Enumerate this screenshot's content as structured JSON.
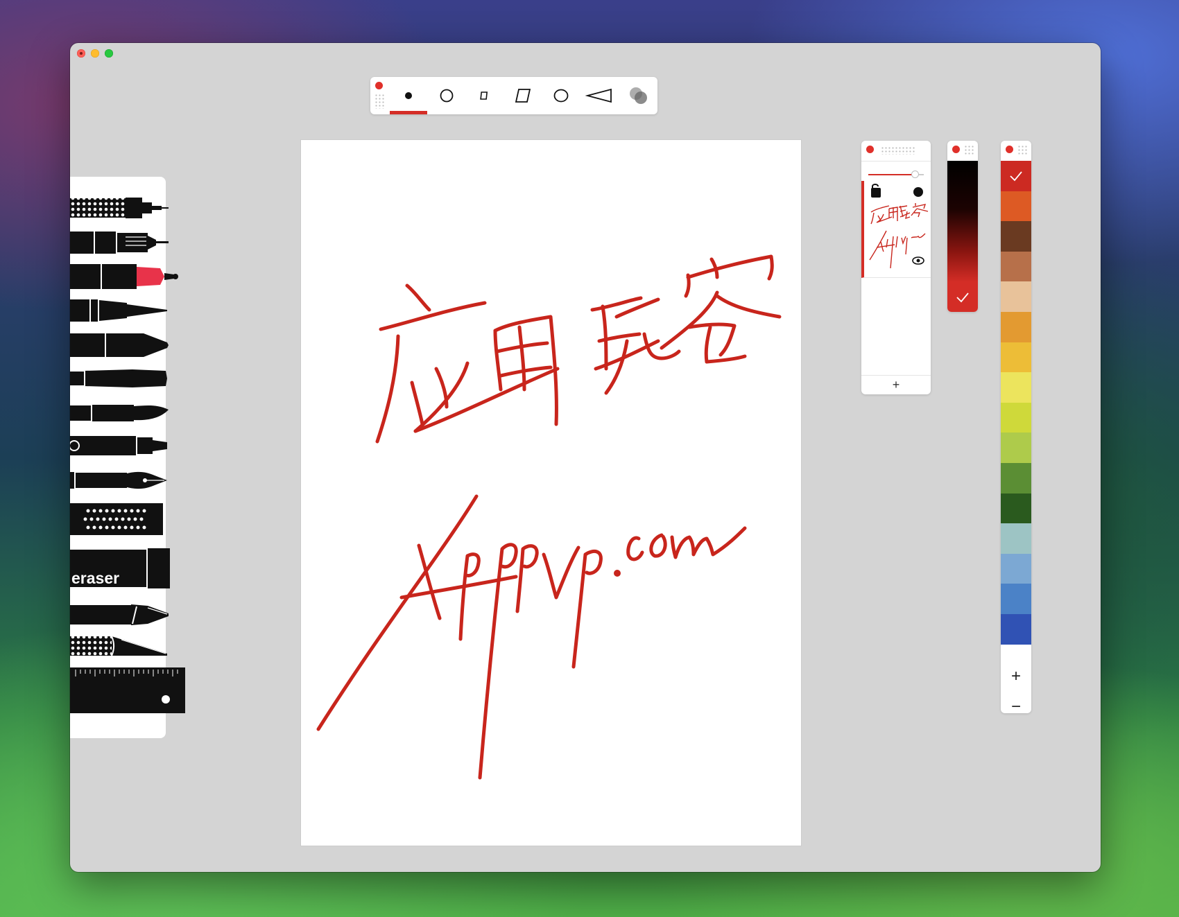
{
  "window": {
    "controls": [
      "close-button",
      "minimize-button",
      "zoom-button"
    ]
  },
  "shape_toolbar": {
    "shapes": [
      "dot",
      "circle",
      "small-square",
      "parallelogram",
      "circle",
      "triangle",
      "blend"
    ],
    "selected": "dot"
  },
  "tools": {
    "eraser_label": "eraser"
  },
  "layers": {
    "add_label": "+"
  },
  "palette": {
    "swatches": [
      "#cc2a22",
      "#dd5a24",
      "#6a3a21",
      "#b7704a",
      "#e8c29a",
      "#e39a31",
      "#edbd37",
      "#ece45d",
      "#cfd93a",
      "#aecb4b",
      "#5b8e34",
      "#2a5a1e",
      "#9dc4c4",
      "#7ca8d3",
      "#4b82c7",
      "#3052b4"
    ],
    "selected_index": 0,
    "plus_label": "+",
    "minus_label": "−"
  },
  "colors": {
    "accent": "#d42d26",
    "ink": "#c8251c"
  }
}
